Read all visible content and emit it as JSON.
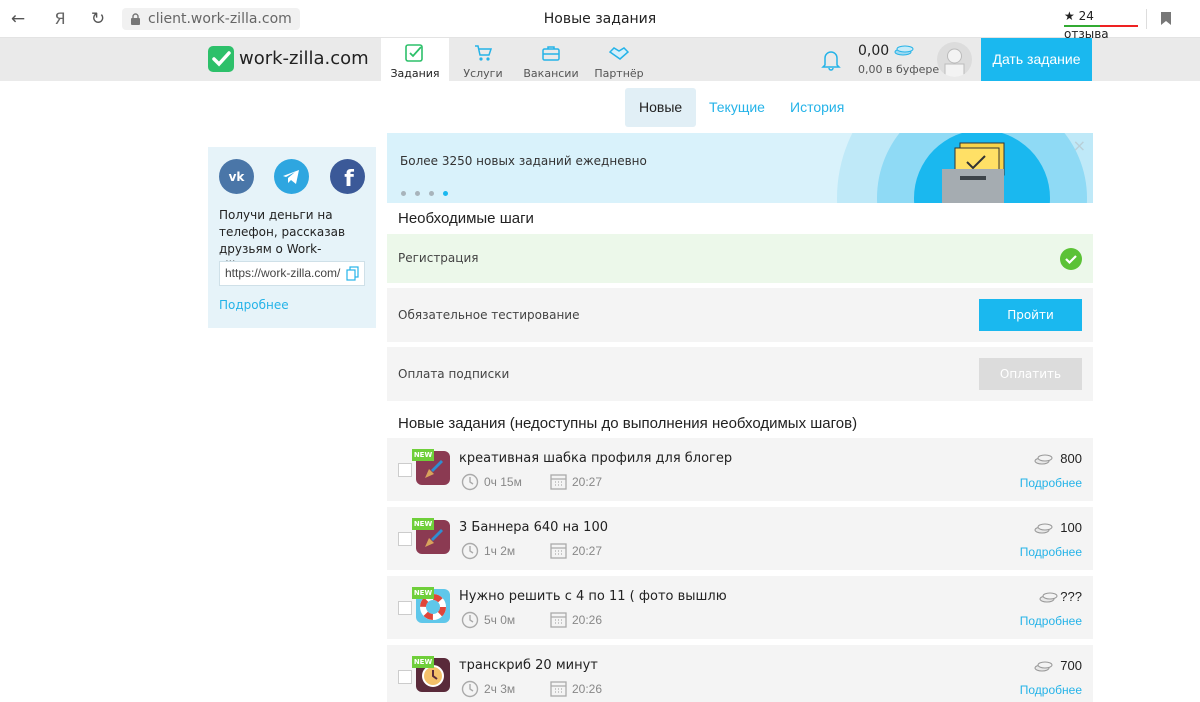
{
  "browser": {
    "url": "client.work-zilla.com",
    "page_title": "Новые задания",
    "reviews": "24 отзыва"
  },
  "header": {
    "logo": "work-zilla.com",
    "nav": [
      {
        "label": "Задания",
        "icon": "tasks-icon"
      },
      {
        "label": "Услуги",
        "icon": "services-icon"
      },
      {
        "label": "Вакансии",
        "icon": "vacancies-icon"
      },
      {
        "label": "Партнёр",
        "icon": "partner-icon"
      }
    ],
    "balance": "0,00",
    "buffer": "0,00 в буфере",
    "give_task": "Дать задание"
  },
  "tabs": [
    "Новые",
    "Текущие",
    "История"
  ],
  "promo": {
    "text": "Получи деньги на телефон, рассказав друзьям о Work-zilla.com",
    "ref_link": "https://work-zilla.com/",
    "more": "Подробнее"
  },
  "banner": {
    "text": "Более 3250 новых заданий ежедневно",
    "close": "×"
  },
  "steps": {
    "title": "Необходимые шаги",
    "items": [
      {
        "label": "Регистрация"
      },
      {
        "label": "Обязательное тестирование",
        "button": "Пройти"
      },
      {
        "label": "Оплата подписки",
        "button": "Оплатить"
      }
    ]
  },
  "tasks": {
    "title": "Новые задания (недоступны до выполнения необходимых шагов)",
    "badge": "NEW",
    "more": "Подробнее",
    "items": [
      {
        "title": "креативная шабка профиля для блогер",
        "duration": "0ч 15м",
        "time": "20:27",
        "price": "800",
        "category_icon": "design-brush-icon"
      },
      {
        "title": "3 Баннера 640 на 100",
        "duration": "1ч 2м",
        "time": "20:27",
        "price": "100",
        "category_icon": "design-brush-icon"
      },
      {
        "title": "Нужно решить с 4 по 11 ( фото вышлю",
        "duration": "5ч 0м",
        "time": "20:26",
        "price": "???",
        "category_icon": "lifebuoy-icon"
      },
      {
        "title": "транскриб 20 минут",
        "duration": "2ч 3м",
        "time": "20:26",
        "price": "700",
        "category_icon": "clock-icon"
      }
    ]
  },
  "colors": {
    "accent": "#1ab8ef",
    "brand_green": "#2dc06a",
    "success": "#5bc236",
    "badge": "#6fcf3a"
  }
}
